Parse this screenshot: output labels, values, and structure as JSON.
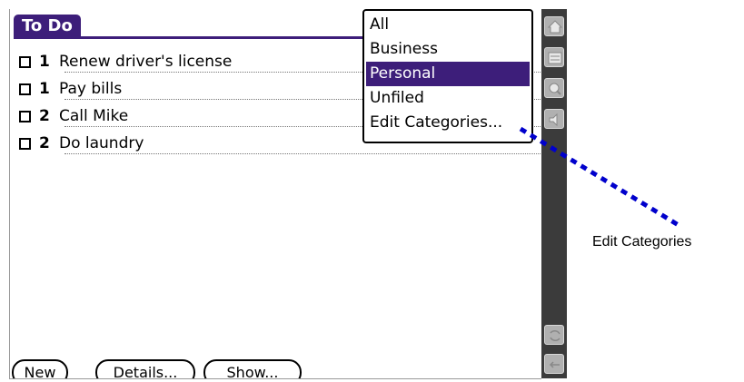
{
  "app": {
    "title": "To Do"
  },
  "todos": [
    {
      "priority": "1",
      "description": "Renew driver's license"
    },
    {
      "priority": "1",
      "description": "Pay bills"
    },
    {
      "priority": "2",
      "description": "Call Mike"
    },
    {
      "priority": "2",
      "description": "Do laundry"
    }
  ],
  "category_menu": {
    "options": [
      "All",
      "Business",
      "Personal",
      "Unfiled",
      "Edit Categories..."
    ],
    "selected": "Personal"
  },
  "buttons": {
    "new": "New",
    "details": "Details...",
    "show": "Show..."
  },
  "silkscreen_icons": [
    "home-icon",
    "menu-icon",
    "find-icon",
    "volume-icon",
    "sync-icon",
    "back-arrow-icon"
  ],
  "callout": {
    "label": "Edit Categories",
    "color": "#0000cc"
  },
  "colors": {
    "accent": "#3d1e7a",
    "silkscreen": "#3b3b3b"
  }
}
